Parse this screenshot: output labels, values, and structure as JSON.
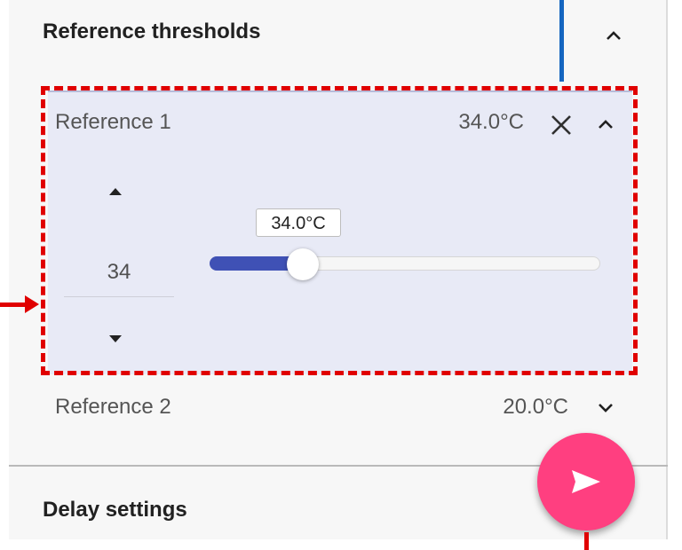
{
  "panel": {
    "section_title": "Reference thresholds",
    "delay_title": "Delay settings"
  },
  "reference1": {
    "label": "Reference 1",
    "value": "34.0°C",
    "stepper_value": "34",
    "slider_tooltip": "34.0°C",
    "slider_fraction": 0.238
  },
  "reference2": {
    "label": "Reference 2",
    "value": "20.0°C"
  },
  "icons": {
    "close": "close-icon",
    "collapse": "chevron-up-icon",
    "expand": "chevron-down-icon",
    "stepper_up": "triangle-up-icon",
    "stepper_down": "triangle-down-icon",
    "send": "send-icon"
  },
  "colors": {
    "accent": "#3f51b5",
    "fab": "#ff3f80",
    "annotation_red": "#e00000",
    "annotation_blue": "#1565c0",
    "expanded_background": "#e8eaf6"
  }
}
